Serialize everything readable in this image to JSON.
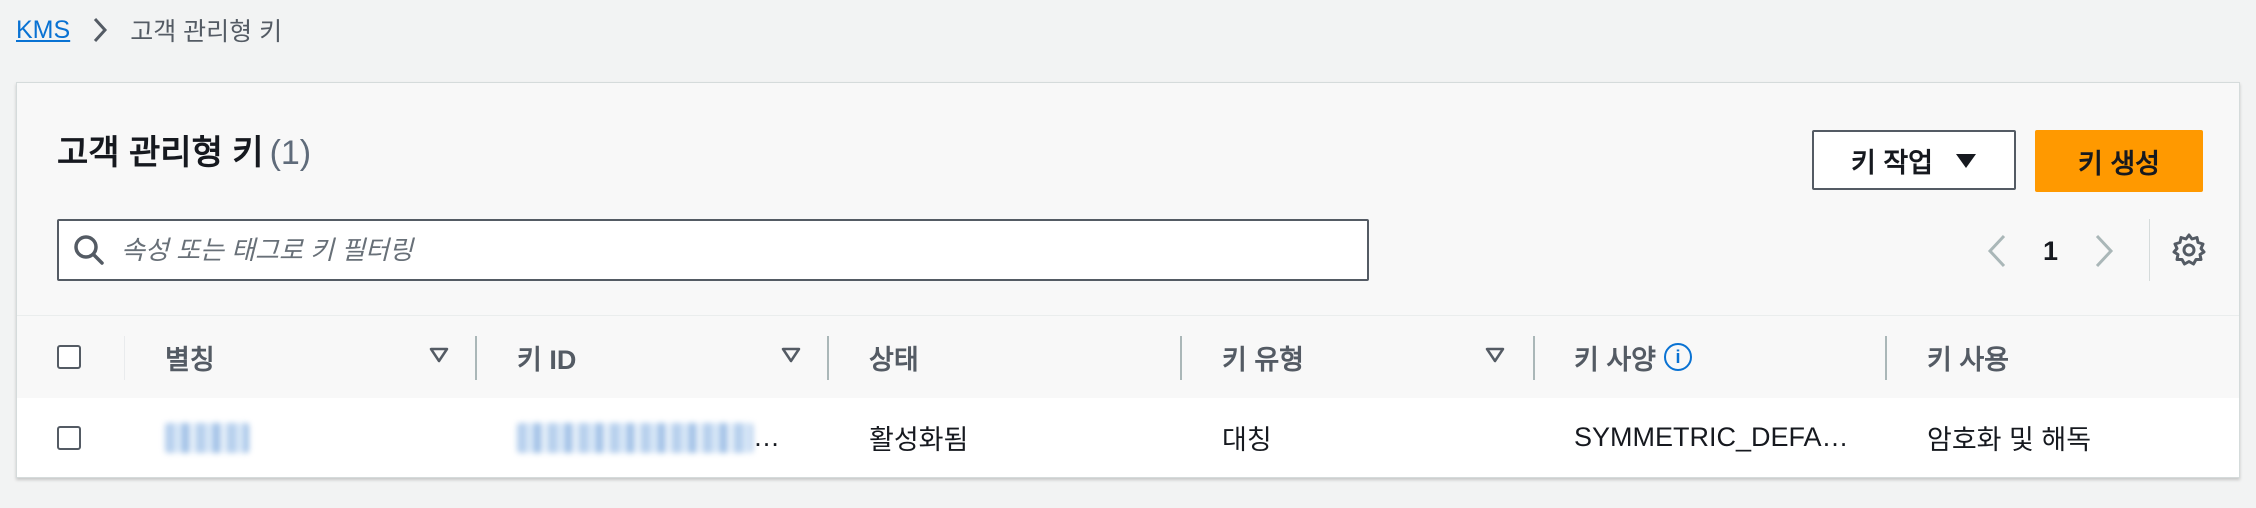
{
  "breadcrumb": {
    "root_label": "KMS",
    "current_label": "고객 관리형 키"
  },
  "header": {
    "title": "고객 관리형 키",
    "count": "(1)",
    "actions_label": "키 작업",
    "create_label": "키 생성"
  },
  "search": {
    "placeholder": "속성 또는 태그로 키 필터링",
    "value": ""
  },
  "pagination": {
    "current_page": "1"
  },
  "table": {
    "columns": [
      {
        "label": "별칭",
        "sortable": true
      },
      {
        "label": "키 ID",
        "sortable": true
      },
      {
        "label": "상태",
        "sortable": false
      },
      {
        "label": "키 유형",
        "sortable": true
      },
      {
        "label": "키 사양",
        "sortable": false,
        "info_icon": "info-icon"
      },
      {
        "label": "키 사용",
        "sortable": false
      }
    ],
    "rows": [
      {
        "alias": "",
        "key_id_suffix": "…",
        "status": "활성화됨",
        "key_type": "대칭",
        "key_spec": "SYMMETRIC_DEFA…",
        "key_usage": "암호화 및 해독"
      }
    ]
  },
  "colors": {
    "accent": "#ff9900",
    "link": "#0972d3",
    "background": "#f2f3f3"
  }
}
